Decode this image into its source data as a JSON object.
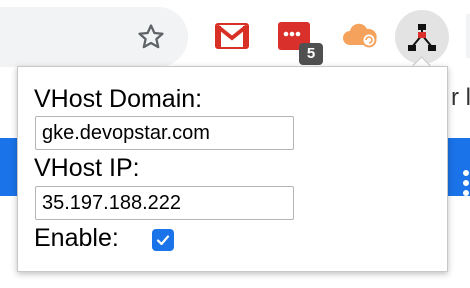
{
  "toolbar": {
    "icons": [
      "star-icon",
      "gmail-icon",
      "todo-extension-icon",
      "cloud-sync-icon",
      "vhost-extension-icon"
    ],
    "todo_badge": "5"
  },
  "page": {
    "right_edge_text": "r l"
  },
  "popup": {
    "domain_label": "VHost Domain:",
    "domain_value": "gke.devopstar.com",
    "ip_label": "VHost IP:",
    "ip_value": "35.197.188.222",
    "enable_label": "Enable:",
    "enable_checked": true
  },
  "colors": {
    "accent": "#1a73e8",
    "gmail_red": "#d93025",
    "todo_red": "#d9302c",
    "cloud_orange": "#f5a25d"
  }
}
